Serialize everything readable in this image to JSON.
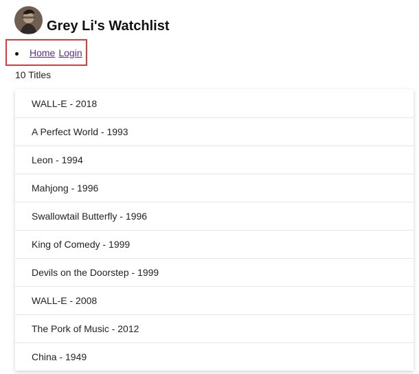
{
  "header": {
    "title": "Grey Li's Watchlist",
    "avatar_icon": "user-avatar-icon"
  },
  "nav": {
    "items": [
      {
        "label": "Home"
      },
      {
        "label": "Login"
      }
    ],
    "link_color": "#5b2d86",
    "highlight_color": "#e03b3b"
  },
  "count_text": "10 Titles",
  "movies": [
    {
      "text": "WALL-E - 2018"
    },
    {
      "text": "A Perfect World - 1993"
    },
    {
      "text": "Leon - 1994"
    },
    {
      "text": "Mahjong - 1996"
    },
    {
      "text": "Swallowtail Butterfly - 1996"
    },
    {
      "text": "King of Comedy - 1999"
    },
    {
      "text": "Devils on the Doorstep - 1999"
    },
    {
      "text": "WALL-E - 2008"
    },
    {
      "text": "The Pork of Music - 2012"
    },
    {
      "text": "China - 1949"
    }
  ]
}
